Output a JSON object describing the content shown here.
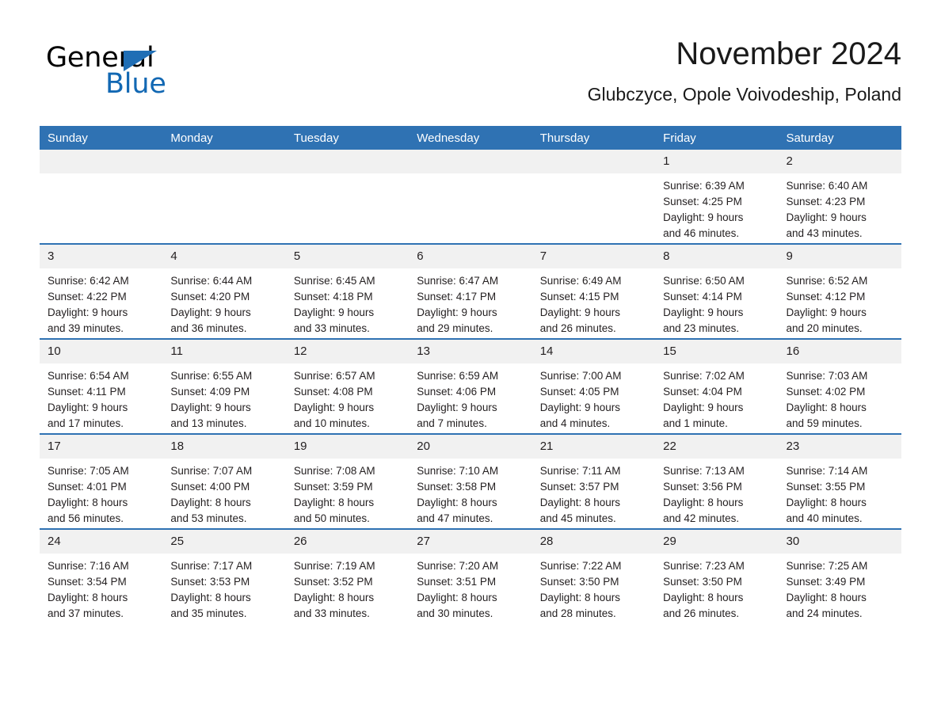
{
  "brand": {
    "name_part1": "General",
    "name_part2": "Blue",
    "triangle_color": "#1f6eb5",
    "blue_color": "#1268b3"
  },
  "header": {
    "title": "November 2024",
    "subtitle": "Glubczyce, Opole Voivodeship, Poland"
  },
  "theme": {
    "header_blue": "#2f72b3",
    "date_band_gray": "#f1f1f1",
    "separator_blue": "#2f72b3"
  },
  "weekday_headers": [
    "Sunday",
    "Monday",
    "Tuesday",
    "Wednesday",
    "Thursday",
    "Friday",
    "Saturday"
  ],
  "weeks": [
    [
      {
        "date": "",
        "sunrise": "",
        "sunset": "",
        "daylight_line1": "",
        "daylight_line2": "",
        "empty": true
      },
      {
        "date": "",
        "sunrise": "",
        "sunset": "",
        "daylight_line1": "",
        "daylight_line2": "",
        "empty": true
      },
      {
        "date": "",
        "sunrise": "",
        "sunset": "",
        "daylight_line1": "",
        "daylight_line2": "",
        "empty": true
      },
      {
        "date": "",
        "sunrise": "",
        "sunset": "",
        "daylight_line1": "",
        "daylight_line2": "",
        "empty": true
      },
      {
        "date": "",
        "sunrise": "",
        "sunset": "",
        "daylight_line1": "",
        "daylight_line2": "",
        "empty": true
      },
      {
        "date": "1",
        "sunrise": "Sunrise: 6:39 AM",
        "sunset": "Sunset: 4:25 PM",
        "daylight_line1": "Daylight: 9 hours",
        "daylight_line2": "and 46 minutes."
      },
      {
        "date": "2",
        "sunrise": "Sunrise: 6:40 AM",
        "sunset": "Sunset: 4:23 PM",
        "daylight_line1": "Daylight: 9 hours",
        "daylight_line2": "and 43 minutes."
      }
    ],
    [
      {
        "date": "3",
        "sunrise": "Sunrise: 6:42 AM",
        "sunset": "Sunset: 4:22 PM",
        "daylight_line1": "Daylight: 9 hours",
        "daylight_line2": "and 39 minutes."
      },
      {
        "date": "4",
        "sunrise": "Sunrise: 6:44 AM",
        "sunset": "Sunset: 4:20 PM",
        "daylight_line1": "Daylight: 9 hours",
        "daylight_line2": "and 36 minutes."
      },
      {
        "date": "5",
        "sunrise": "Sunrise: 6:45 AM",
        "sunset": "Sunset: 4:18 PM",
        "daylight_line1": "Daylight: 9 hours",
        "daylight_line2": "and 33 minutes."
      },
      {
        "date": "6",
        "sunrise": "Sunrise: 6:47 AM",
        "sunset": "Sunset: 4:17 PM",
        "daylight_line1": "Daylight: 9 hours",
        "daylight_line2": "and 29 minutes."
      },
      {
        "date": "7",
        "sunrise": "Sunrise: 6:49 AM",
        "sunset": "Sunset: 4:15 PM",
        "daylight_line1": "Daylight: 9 hours",
        "daylight_line2": "and 26 minutes."
      },
      {
        "date": "8",
        "sunrise": "Sunrise: 6:50 AM",
        "sunset": "Sunset: 4:14 PM",
        "daylight_line1": "Daylight: 9 hours",
        "daylight_line2": "and 23 minutes."
      },
      {
        "date": "9",
        "sunrise": "Sunrise: 6:52 AM",
        "sunset": "Sunset: 4:12 PM",
        "daylight_line1": "Daylight: 9 hours",
        "daylight_line2": "and 20 minutes."
      }
    ],
    [
      {
        "date": "10",
        "sunrise": "Sunrise: 6:54 AM",
        "sunset": "Sunset: 4:11 PM",
        "daylight_line1": "Daylight: 9 hours",
        "daylight_line2": "and 17 minutes."
      },
      {
        "date": "11",
        "sunrise": "Sunrise: 6:55 AM",
        "sunset": "Sunset: 4:09 PM",
        "daylight_line1": "Daylight: 9 hours",
        "daylight_line2": "and 13 minutes."
      },
      {
        "date": "12",
        "sunrise": "Sunrise: 6:57 AM",
        "sunset": "Sunset: 4:08 PM",
        "daylight_line1": "Daylight: 9 hours",
        "daylight_line2": "and 10 minutes."
      },
      {
        "date": "13",
        "sunrise": "Sunrise: 6:59 AM",
        "sunset": "Sunset: 4:06 PM",
        "daylight_line1": "Daylight: 9 hours",
        "daylight_line2": "and 7 minutes."
      },
      {
        "date": "14",
        "sunrise": "Sunrise: 7:00 AM",
        "sunset": "Sunset: 4:05 PM",
        "daylight_line1": "Daylight: 9 hours",
        "daylight_line2": "and 4 minutes."
      },
      {
        "date": "15",
        "sunrise": "Sunrise: 7:02 AM",
        "sunset": "Sunset: 4:04 PM",
        "daylight_line1": "Daylight: 9 hours",
        "daylight_line2": "and 1 minute."
      },
      {
        "date": "16",
        "sunrise": "Sunrise: 7:03 AM",
        "sunset": "Sunset: 4:02 PM",
        "daylight_line1": "Daylight: 8 hours",
        "daylight_line2": "and 59 minutes."
      }
    ],
    [
      {
        "date": "17",
        "sunrise": "Sunrise: 7:05 AM",
        "sunset": "Sunset: 4:01 PM",
        "daylight_line1": "Daylight: 8 hours",
        "daylight_line2": "and 56 minutes."
      },
      {
        "date": "18",
        "sunrise": "Sunrise: 7:07 AM",
        "sunset": "Sunset: 4:00 PM",
        "daylight_line1": "Daylight: 8 hours",
        "daylight_line2": "and 53 minutes."
      },
      {
        "date": "19",
        "sunrise": "Sunrise: 7:08 AM",
        "sunset": "Sunset: 3:59 PM",
        "daylight_line1": "Daylight: 8 hours",
        "daylight_line2": "and 50 minutes."
      },
      {
        "date": "20",
        "sunrise": "Sunrise: 7:10 AM",
        "sunset": "Sunset: 3:58 PM",
        "daylight_line1": "Daylight: 8 hours",
        "daylight_line2": "and 47 minutes."
      },
      {
        "date": "21",
        "sunrise": "Sunrise: 7:11 AM",
        "sunset": "Sunset: 3:57 PM",
        "daylight_line1": "Daylight: 8 hours",
        "daylight_line2": "and 45 minutes."
      },
      {
        "date": "22",
        "sunrise": "Sunrise: 7:13 AM",
        "sunset": "Sunset: 3:56 PM",
        "daylight_line1": "Daylight: 8 hours",
        "daylight_line2": "and 42 minutes."
      },
      {
        "date": "23",
        "sunrise": "Sunrise: 7:14 AM",
        "sunset": "Sunset: 3:55 PM",
        "daylight_line1": "Daylight: 8 hours",
        "daylight_line2": "and 40 minutes."
      }
    ],
    [
      {
        "date": "24",
        "sunrise": "Sunrise: 7:16 AM",
        "sunset": "Sunset: 3:54 PM",
        "daylight_line1": "Daylight: 8 hours",
        "daylight_line2": "and 37 minutes."
      },
      {
        "date": "25",
        "sunrise": "Sunrise: 7:17 AM",
        "sunset": "Sunset: 3:53 PM",
        "daylight_line1": "Daylight: 8 hours",
        "daylight_line2": "and 35 minutes."
      },
      {
        "date": "26",
        "sunrise": "Sunrise: 7:19 AM",
        "sunset": "Sunset: 3:52 PM",
        "daylight_line1": "Daylight: 8 hours",
        "daylight_line2": "and 33 minutes."
      },
      {
        "date": "27",
        "sunrise": "Sunrise: 7:20 AM",
        "sunset": "Sunset: 3:51 PM",
        "daylight_line1": "Daylight: 8 hours",
        "daylight_line2": "and 30 minutes."
      },
      {
        "date": "28",
        "sunrise": "Sunrise: 7:22 AM",
        "sunset": "Sunset: 3:50 PM",
        "daylight_line1": "Daylight: 8 hours",
        "daylight_line2": "and 28 minutes."
      },
      {
        "date": "29",
        "sunrise": "Sunrise: 7:23 AM",
        "sunset": "Sunset: 3:50 PM",
        "daylight_line1": "Daylight: 8 hours",
        "daylight_line2": "and 26 minutes."
      },
      {
        "date": "30",
        "sunrise": "Sunrise: 7:25 AM",
        "sunset": "Sunset: 3:49 PM",
        "daylight_line1": "Daylight: 8 hours",
        "daylight_line2": "and 24 minutes."
      }
    ]
  ]
}
